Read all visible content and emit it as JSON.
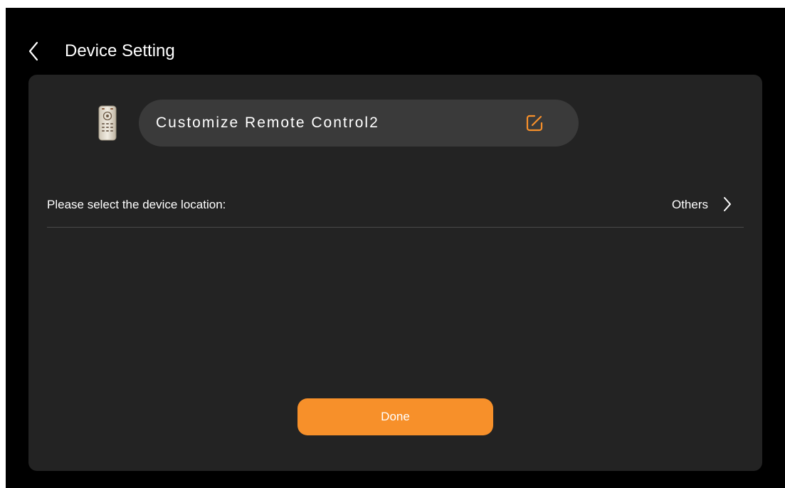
{
  "header": {
    "back_icon": "chevron-left-icon",
    "title": "Device Setting"
  },
  "device": {
    "icon": "remote-control-icon",
    "name": "Customize Remote Control2",
    "edit_icon": "edit-icon"
  },
  "location": {
    "label": "Please select the device location:",
    "value": "Others",
    "chevron_icon": "chevron-right-icon"
  },
  "actions": {
    "done_label": "Done"
  },
  "colors": {
    "background": "#000000",
    "card": "#232323",
    "pill": "#3a3a3a",
    "accent": "#f7902a",
    "text": "#ffffff"
  }
}
